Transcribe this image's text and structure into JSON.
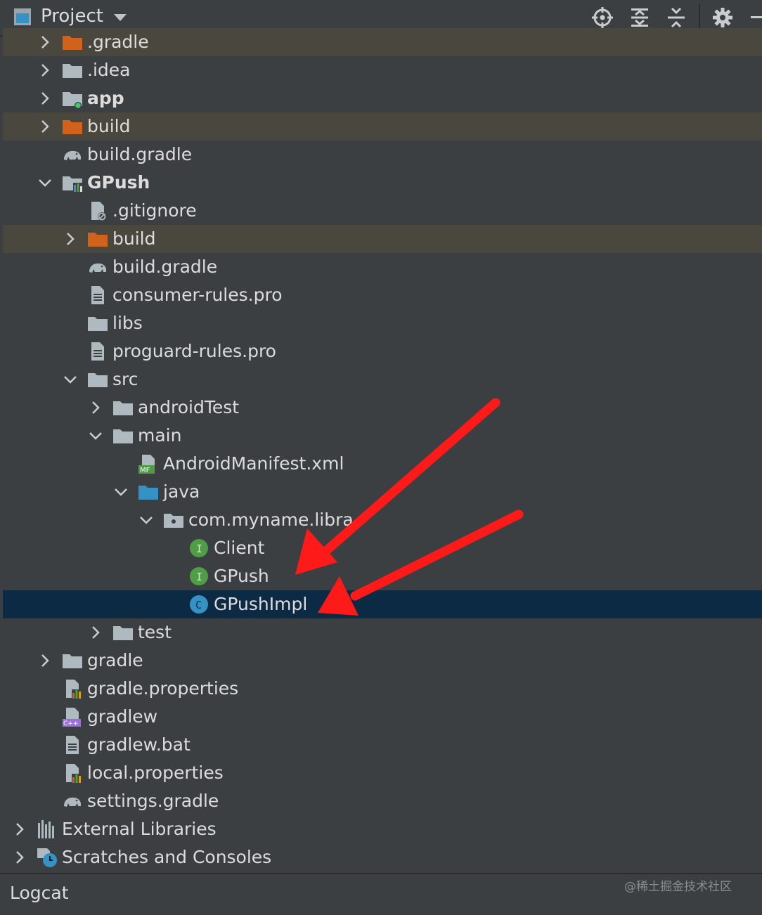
{
  "header": {
    "title": "Project"
  },
  "toolbar": [
    {
      "name": "locate-icon"
    },
    {
      "name": "expand-all-icon"
    },
    {
      "name": "collapse-all-icon"
    },
    {
      "name": "gear-icon"
    }
  ],
  "tree": [
    {
      "label": ".gradle",
      "depth": 0,
      "chevron": "right",
      "icon": "folder-orange",
      "bold": false,
      "highlight": "build"
    },
    {
      "label": ".idea",
      "depth": 0,
      "chevron": "right",
      "icon": "folder",
      "bold": false,
      "highlight": ""
    },
    {
      "label": "app",
      "depth": 0,
      "chevron": "right",
      "icon": "module-folder",
      "bold": true,
      "highlight": ""
    },
    {
      "label": "build",
      "depth": 0,
      "chevron": "right",
      "icon": "folder-orange",
      "bold": false,
      "highlight": "build"
    },
    {
      "label": "build.gradle",
      "depth": 0,
      "chevron": "",
      "icon": "gradle-elephant",
      "bold": false,
      "highlight": ""
    },
    {
      "label": "GPush",
      "depth": 0,
      "chevron": "down",
      "icon": "library-module-folder",
      "bold": true,
      "highlight": ""
    },
    {
      "label": ".gitignore",
      "depth": 1,
      "chevron": "",
      "icon": "ignore-file",
      "bold": false,
      "highlight": ""
    },
    {
      "label": "build",
      "depth": 1,
      "chevron": "right",
      "icon": "folder-orange",
      "bold": false,
      "highlight": "build"
    },
    {
      "label": "build.gradle",
      "depth": 1,
      "chevron": "",
      "icon": "gradle-elephant",
      "bold": false,
      "highlight": ""
    },
    {
      "label": "consumer-rules.pro",
      "depth": 1,
      "chevron": "",
      "icon": "text-file",
      "bold": false,
      "highlight": ""
    },
    {
      "label": "libs",
      "depth": 1,
      "chevron": "",
      "icon": "folder",
      "bold": false,
      "highlight": ""
    },
    {
      "label": "proguard-rules.pro",
      "depth": 1,
      "chevron": "",
      "icon": "text-file",
      "bold": false,
      "highlight": ""
    },
    {
      "label": "src",
      "depth": 1,
      "chevron": "down",
      "icon": "folder",
      "bold": false,
      "highlight": ""
    },
    {
      "label": "androidTest",
      "depth": 2,
      "chevron": "right",
      "icon": "folder",
      "bold": false,
      "highlight": ""
    },
    {
      "label": "main",
      "depth": 2,
      "chevron": "down",
      "icon": "folder",
      "bold": false,
      "highlight": ""
    },
    {
      "label": "AndroidManifest.xml",
      "depth": 3,
      "chevron": "",
      "icon": "manifest-file",
      "bold": false,
      "highlight": ""
    },
    {
      "label": "java",
      "depth": 3,
      "chevron": "down",
      "icon": "folder-blue",
      "bold": false,
      "highlight": ""
    },
    {
      "label": "com.myname.libra",
      "depth": 4,
      "chevron": "down",
      "icon": "package-folder",
      "bold": false,
      "highlight": ""
    },
    {
      "label": "Client",
      "depth": 5,
      "chevron": "",
      "icon": "interface-icon",
      "bold": false,
      "highlight": ""
    },
    {
      "label": "GPush",
      "depth": 5,
      "chevron": "",
      "icon": "interface-icon",
      "bold": false,
      "highlight": ""
    },
    {
      "label": "GPushImpl",
      "depth": 5,
      "chevron": "",
      "icon": "class-icon",
      "bold": false,
      "highlight": "selected"
    },
    {
      "label": "test",
      "depth": 2,
      "chevron": "right",
      "icon": "folder",
      "bold": false,
      "highlight": ""
    },
    {
      "label": "gradle",
      "depth": 0,
      "chevron": "right",
      "icon": "folder",
      "bold": false,
      "highlight": ""
    },
    {
      "label": "gradle.properties",
      "depth": 0,
      "chevron": "",
      "icon": "properties-file",
      "bold": false,
      "highlight": ""
    },
    {
      "label": "gradlew",
      "depth": 0,
      "chevron": "",
      "icon": "cpp-file",
      "bold": false,
      "highlight": ""
    },
    {
      "label": "gradlew.bat",
      "depth": 0,
      "chevron": "",
      "icon": "text-file",
      "bold": false,
      "highlight": ""
    },
    {
      "label": "local.properties",
      "depth": 0,
      "chevron": "",
      "icon": "properties-file",
      "bold": false,
      "highlight": ""
    },
    {
      "label": "settings.gradle",
      "depth": 0,
      "chevron": "",
      "icon": "gradle-elephant",
      "bold": false,
      "highlight": ""
    },
    {
      "label": "External Libraries",
      "depth": -1,
      "chevron": "right",
      "icon": "libraries-icon",
      "bold": false,
      "highlight": ""
    },
    {
      "label": "Scratches and Consoles",
      "depth": -1,
      "chevron": "right",
      "icon": "scratches-icon",
      "bold": false,
      "highlight": ""
    }
  ],
  "bottom": {
    "tab": "Logcat",
    "watermark": "@稀土掘金技术社区"
  },
  "colors": {
    "background": "#3c3f41",
    "build_highlight": "#4a473f",
    "selected_row": "#0d2a44",
    "folder": "#aeb9c0",
    "folder_orange": "#d0621c",
    "folder_blue": "#3592c4",
    "interface": "#4f9e45",
    "class": "#3592c4",
    "arrow": "#ff1a1a"
  }
}
